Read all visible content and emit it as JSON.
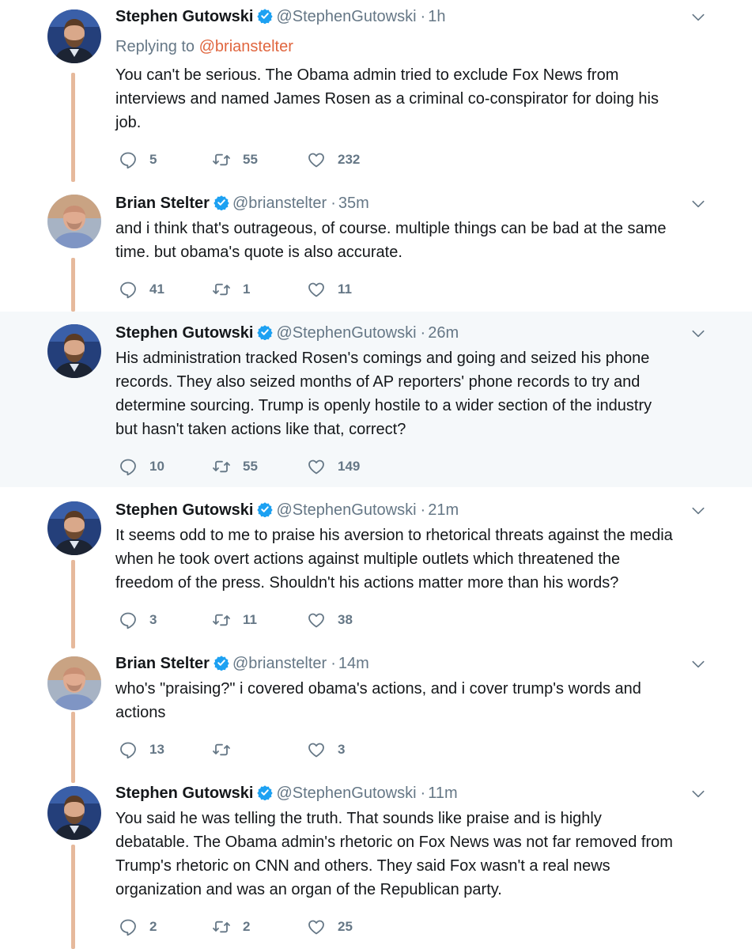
{
  "tweets": [
    {
      "name": "Stephen Gutowski",
      "handle": "@StephenGutowski",
      "dot": "·",
      "time": "1h",
      "replying_prefix": "Replying to",
      "replying_to": "@brianstelter",
      "text": "You can't be serious. The Obama admin tried to exclude Fox News from\ninterviews and named James Rosen as a criminal co-conspirator for doing his\njob.",
      "replies": "5",
      "retweets": "55",
      "likes": "232"
    },
    {
      "name": "Brian Stelter",
      "handle": "@brianstelter",
      "dot": "·",
      "time": "35m",
      "text": "and i think that's outrageous, of course. multiple things can be bad at the same\ntime. but obama's quote is also accurate.",
      "replies": "41",
      "retweets": "1",
      "likes": "11"
    },
    {
      "name": "Stephen Gutowski",
      "handle": "@StephenGutowski",
      "dot": "·",
      "time": "26m",
      "text": "His administration tracked Rosen's comings and going and seized his phone\nrecords. They also seized months of AP reporters' phone records to try and\ndetermine sourcing. Trump is openly hostile to a wider section of the industry\nbut hasn't taken actions like that, correct?",
      "replies": "10",
      "retweets": "55",
      "likes": "149"
    },
    {
      "name": "Stephen Gutowski",
      "handle": "@StephenGutowski",
      "dot": "·",
      "time": "21m",
      "text": "It seems odd to me to praise his aversion to rhetorical threats against the media\nwhen he took overt actions against multiple outlets which threatened the\nfreedom of the press. Shouldn't his actions matter more than his words?",
      "replies": "3",
      "retweets": "11",
      "likes": "38"
    },
    {
      "name": "Brian Stelter",
      "handle": "@brianstelter",
      "dot": "·",
      "time": "14m",
      "text": "who's \"praising?\" i covered obama's actions, and i cover trump's words and\nactions",
      "replies": "13",
      "retweets": "",
      "likes": "3"
    },
    {
      "name": "Stephen Gutowski",
      "handle": "@StephenGutowski",
      "dot": "·",
      "time": "11m",
      "text": "You said he was telling the truth. That sounds like praise and is highly\ndebatable. The Obama admin's rhetoric on Fox News was not far removed from\nTrump's rhetoric on CNN and others. They said Fox wasn't a real news\norganization and was an organ of the Republican party.",
      "replies": "2",
      "retweets": "2",
      "likes": "25"
    }
  ],
  "icons": {
    "verified": "verified-badge-icon",
    "reply": "reply-bubble-icon",
    "retweet": "retweet-arrows-icon",
    "like": "heart-icon",
    "menu": "chevron-down-icon"
  },
  "colors": {
    "accent_link": "#e0663f",
    "verified_blue": "#1da1f2",
    "thread_line": "#e6b99c",
    "muted_text": "#657786",
    "highlight_bg": "#f5f8fa"
  }
}
